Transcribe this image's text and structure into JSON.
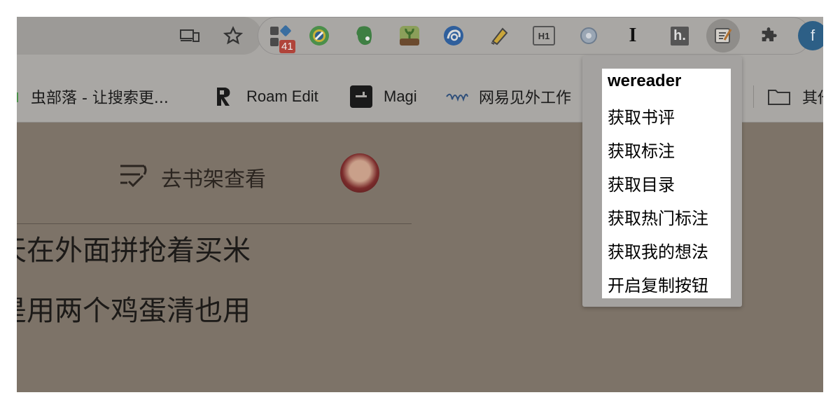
{
  "toolbar": {
    "extensions": [
      {
        "name": "apps-icon",
        "badge": "41"
      },
      {
        "name": "chrome-green-icon"
      },
      {
        "name": "evernote-icon"
      },
      {
        "name": "forest-icon"
      },
      {
        "name": "edge-blue-icon"
      },
      {
        "name": "highlighter-icon"
      },
      {
        "name": "h1-icon",
        "label": "H1"
      },
      {
        "name": "disc-icon"
      },
      {
        "name": "instapaper-icon",
        "label": "I"
      },
      {
        "name": "hypothesis-icon",
        "label": "h."
      },
      {
        "name": "wereader-note-icon"
      },
      {
        "name": "puzzle-icon"
      },
      {
        "name": "profile-avatar",
        "label": "f"
      }
    ]
  },
  "bookmarks": [
    {
      "label": "虫部落 - 让搜索更..."
    },
    {
      "label": "Roam Edit"
    },
    {
      "label": "Magi"
    },
    {
      "label": "网易见外工作"
    },
    {
      "label": "其他"
    }
  ],
  "page": {
    "shelf_label": "去书架查看",
    "line1": "天在外面拼抢着买米",
    "line2": "是用两个鸡蛋清也用"
  },
  "popup": {
    "title": "wereader",
    "items": [
      "获取书评",
      "获取标注",
      "获取目录",
      "获取热门标注",
      "获取我的想法",
      "开启复制按钮"
    ]
  }
}
